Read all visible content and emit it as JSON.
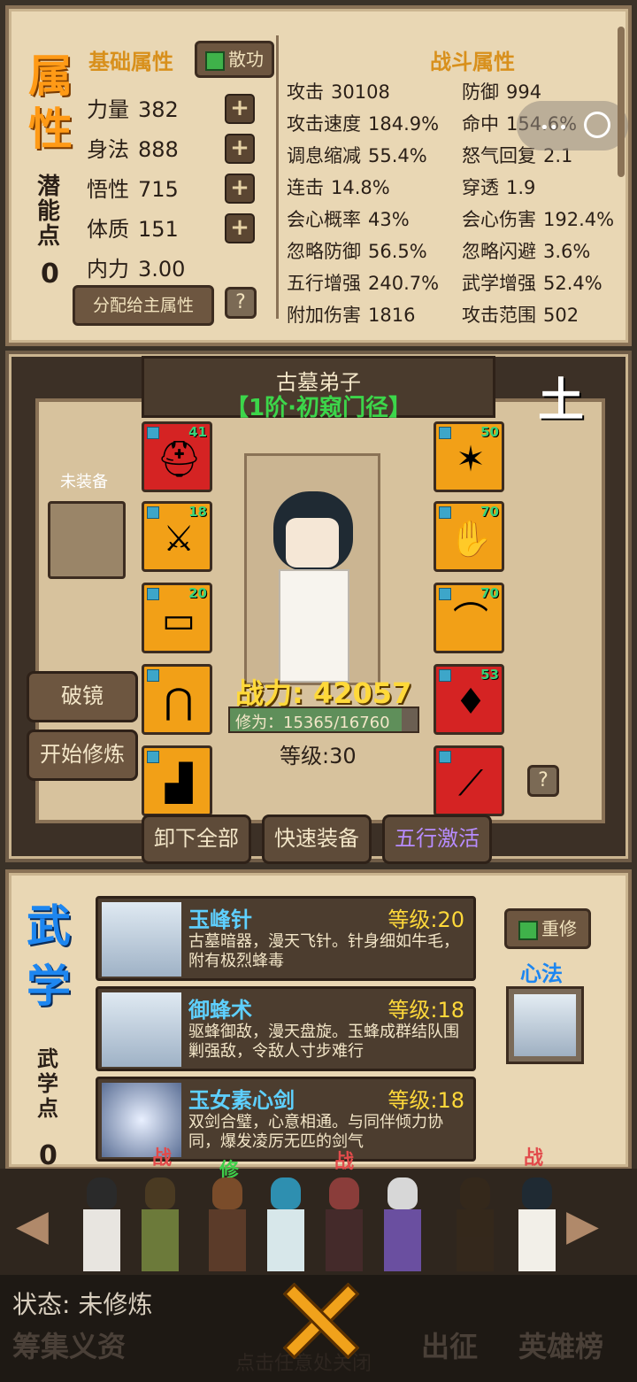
{
  "attributes": {
    "title_chars": [
      "属",
      "性"
    ],
    "base_label": "基础属性",
    "sanggong_label": "散功",
    "potential_label_chars": [
      "潜",
      "能",
      "点"
    ],
    "potential_value": "0",
    "stats": [
      {
        "name": "力量",
        "value": "382"
      },
      {
        "name": "身法",
        "value": "888"
      },
      {
        "name": "悟性",
        "value": "715"
      },
      {
        "name": "体质",
        "value": "151"
      },
      {
        "name": "内力",
        "value": "3.00"
      }
    ],
    "assign_label": "分配给主属性",
    "help_label": "?",
    "combat_title": "战斗属性",
    "combat": [
      {
        "name": "攻击",
        "value": "30108"
      },
      {
        "name": "防御",
        "value": "994"
      },
      {
        "name": "攻击速度",
        "value": "184.9%"
      },
      {
        "name": "命中",
        "value": "154.6%"
      },
      {
        "name": "调息缩减",
        "value": "55.4%"
      },
      {
        "name": "怒气回复",
        "value": "2.1"
      },
      {
        "name": "连击",
        "value": "14.8%"
      },
      {
        "name": "穿透",
        "value": "1.9"
      },
      {
        "name": "会心概率",
        "value": "43%"
      },
      {
        "name": "会心伤害",
        "value": "192.4%"
      },
      {
        "name": "忽略防御",
        "value": "56.5%"
      },
      {
        "name": "忽略闪避",
        "value": "3.6%"
      },
      {
        "name": "五行增强",
        "value": "240.7%"
      },
      {
        "name": "武学增强",
        "value": "52.4%"
      },
      {
        "name": "附加伤害",
        "value": "1816"
      },
      {
        "name": "攻击范围",
        "value": "502"
      }
    ]
  },
  "hero": {
    "name": "古墓弟子",
    "rank": "【1阶·初窥门径】",
    "element": "土",
    "unequipped_label": "未装备",
    "power": "战力: 42057",
    "cultivation": "修为：15365/16760",
    "cultivation_fraction": 0.917,
    "level": "等级:30",
    "breakthrough_label": "破镜",
    "start_train_label": "开始修炼",
    "left_slots": [
      {
        "icon": "helmet-icon",
        "glyph": "⛑",
        "level": "41",
        "bg": "#d52323"
      },
      {
        "icon": "armor-icon",
        "glyph": "⚔",
        "level": "18",
        "bg": "#f2a017"
      },
      {
        "icon": "belt-icon",
        "glyph": "▭",
        "level": "20",
        "bg": "#f2a017"
      },
      {
        "icon": "pants-icon",
        "glyph": "⋂",
        "level": "",
        "bg": "#f2a017"
      },
      {
        "icon": "boots-icon",
        "glyph": "▟",
        "level": "",
        "bg": "#f2a017"
      }
    ],
    "right_slots": [
      {
        "icon": "amulet-icon",
        "glyph": "✶",
        "level": "50",
        "bg": "#f2a017"
      },
      {
        "icon": "gloves-icon",
        "glyph": "✋",
        "level": "70",
        "bg": "#f2a017"
      },
      {
        "icon": "scroll-icon",
        "glyph": "⌒",
        "level": "70",
        "bg": "#f2a017"
      },
      {
        "icon": "pouch-icon",
        "glyph": "♦",
        "level": "53",
        "bg": "#d52323"
      },
      {
        "icon": "sword-icon",
        "glyph": "⟋",
        "level": "",
        "bg": "#d52323"
      }
    ],
    "unequip_all_label": "卸下全部",
    "quick_equip_label": "快速装备",
    "wuxing_label": "五行激活"
  },
  "skills": {
    "title_chars": [
      "武",
      "学"
    ],
    "points_label_chars": [
      "武",
      "学",
      "点"
    ],
    "points_value": "0",
    "retrain_label": "重修",
    "xinfa_label": "心法",
    "list": [
      {
        "name": "玉峰针",
        "level": "等级:20",
        "desc": "古墓暗器，漫天飞针。针身细如牛毛，附有极烈蜂毒"
      },
      {
        "name": "御蜂术",
        "level": "等级:18",
        "desc": "驱蜂御敌，漫天盘旋。玉蜂成群结队围剿强敌，令敌人寸步难行"
      },
      {
        "name": "玉女素心剑",
        "level": "等级:18",
        "desc": "双剑合璧，心意相通。与同伴倾力协同，爆发凌厉无匹的剑气"
      }
    ]
  },
  "party": {
    "tags": [
      {
        "text": "战",
        "color": "#e24b4b"
      },
      {
        "text": "修",
        "color": "#3ed04a"
      },
      {
        "text": "战",
        "color": "#e24b4b"
      },
      {
        "text": "战",
        "color": "#e24b4b"
      }
    ]
  },
  "footer": {
    "status": "状态: 未修炼",
    "fund": "筹集义资",
    "expedition": "出征",
    "ranking": "英雄榜",
    "close_hint": "点击任意处关闭"
  }
}
